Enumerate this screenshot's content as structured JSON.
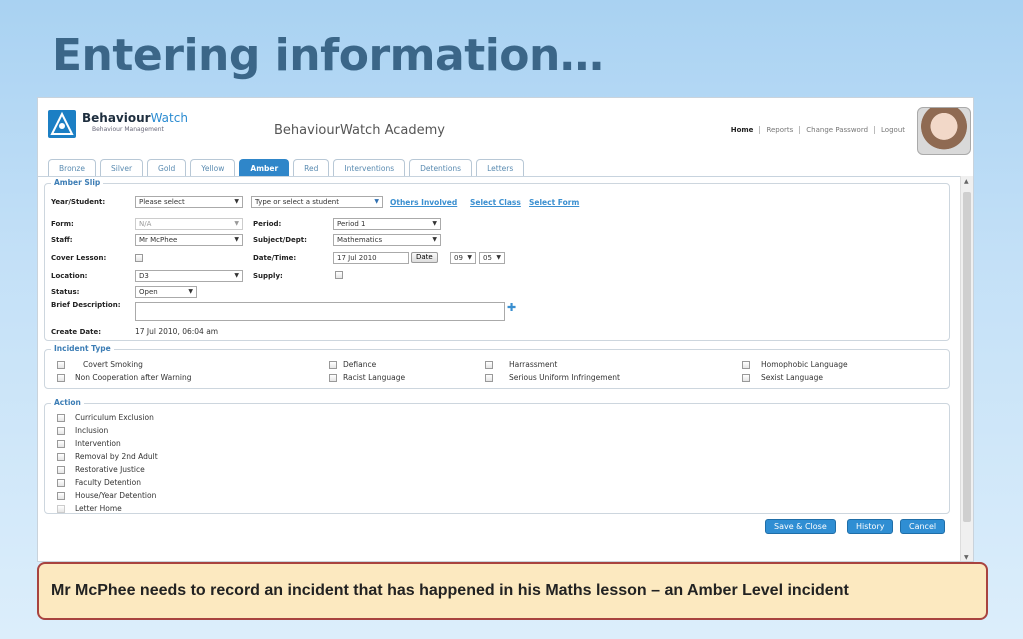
{
  "slide": {
    "title": "Entering information…",
    "caption": "Mr McPhee needs to record an incident that has happened in his Maths lesson – an Amber Level incident"
  },
  "app": {
    "brand_strong": "Behaviour",
    "brand_light": "Watch",
    "brand_sub": "Behaviour Management",
    "academy": "BehaviourWatch Academy",
    "nav": [
      "Home",
      "Reports",
      "Change Password",
      "Logout"
    ],
    "tabs": [
      "Bronze",
      "Silver",
      "Gold",
      "Yellow",
      "Amber",
      "Red",
      "Interventions",
      "Detentions",
      "Letters"
    ],
    "active_tab": "Amber"
  },
  "amber_slip": {
    "legend": "Amber Slip",
    "year_student_label": "Year/Student:",
    "year_student_value": "Please select",
    "student_value": "Type or select a student",
    "links": [
      "Others Involved",
      "Select Class",
      "Select Form"
    ],
    "form_label": "Form:",
    "form_value": "N/A",
    "period_label": "Period:",
    "period_value": "Period 1",
    "staff_label": "Staff:",
    "staff_value": "Mr McPhee",
    "subject_label": "Subject/Dept:",
    "subject_value": "Mathematics",
    "cover_label": "Cover Lesson:",
    "datetime_label": "Date/Time:",
    "date_value": "17 Jul 2010",
    "date_button": "Date",
    "hour_value": "09",
    "minute_value": "05",
    "location_label": "Location:",
    "location_value": "D3",
    "supply_label": "Supply:",
    "status_label": "Status:",
    "status_value": "Open",
    "brief_label": "Brief Description:",
    "create_label": "Create Date:",
    "create_value": "17 Jul 2010, 06:04 am"
  },
  "incident_type": {
    "legend": "Incident Type",
    "items": [
      "Covert Smoking",
      "Defiance",
      "Harrassment",
      "Homophobic Language",
      "Non Cooperation after Warning",
      "Racist Language",
      "Serious Uniform Infringement",
      "Sexist Language"
    ]
  },
  "action": {
    "legend": "Action",
    "items": [
      "Curriculum Exclusion",
      "Inclusion",
      "Intervention",
      "Removal by 2nd Adult",
      "Restorative Justice",
      "Faculty Detention",
      "House/Year Detention",
      "Letter Home"
    ]
  },
  "buttons": {
    "save": "Save & Close",
    "history": "History",
    "cancel": "Cancel"
  },
  "colors": {
    "accent": "#2f86c9",
    "title": "#3b6688",
    "caption_bg": "#fce9c0",
    "caption_border": "#a8433f"
  }
}
